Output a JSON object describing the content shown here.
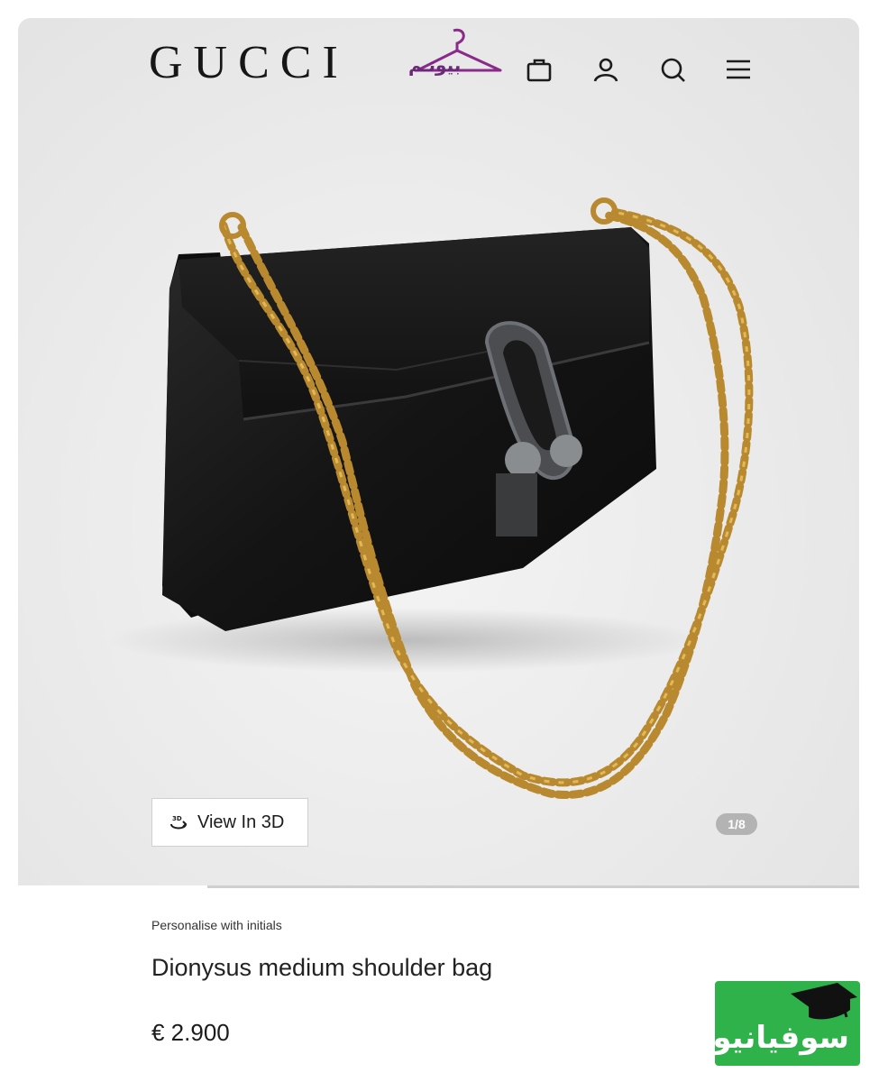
{
  "header": {
    "brand": "GUCCI",
    "watermark_text": "بیوتـم",
    "icons": [
      "shopping-bag-icon",
      "account-icon",
      "search-icon",
      "menu-icon"
    ]
  },
  "gallery": {
    "view_3d_label": "View In 3D",
    "pager_text": "1/8",
    "progress_fraction": 0.125
  },
  "product": {
    "personalise_label": "Personalise with initials",
    "name": "Dionysus medium shoulder bag",
    "price": "€ 2.900"
  },
  "corner_badge": {
    "text": "سوفیانیوز",
    "color": "#2fb24a"
  },
  "colors": {
    "background": "#e9e9e9",
    "bag": "#151515",
    "chain": "#b8892f"
  }
}
